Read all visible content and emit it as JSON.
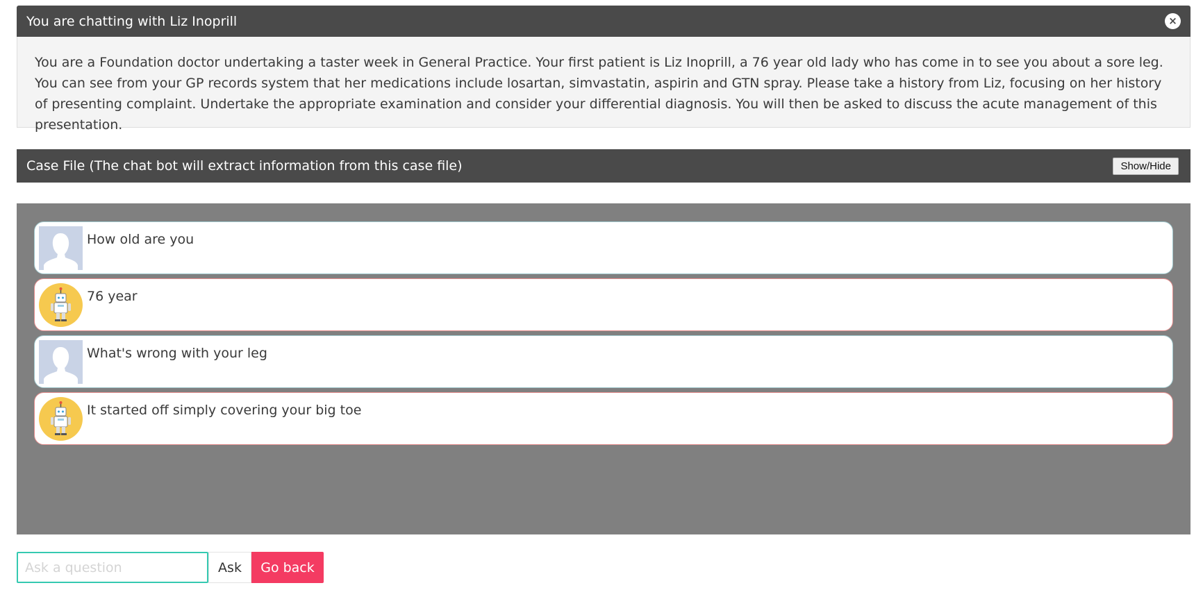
{
  "chat_panel": {
    "title": "You are chatting with Liz Inoprill",
    "close_label": "×",
    "intro_text": "You are a Foundation doctor undertaking a taster week in General Practice. Your first patient is Liz Inoprill, a 76 year old lady who has come in to see you about a sore leg. You can see from your GP records system that her medications include losartan, simvastatin, aspirin and GTN spray. Please take a history from Liz, focusing on her history of presenting complaint. Undertake the appropriate examination and consider your differential diagnosis. You will then be asked to discuss the acute management of this presentation."
  },
  "case_file": {
    "title": "Case File (The chat bot will extract information from this case file)",
    "toggle_label": "Show/Hide"
  },
  "messages": [
    {
      "sender": "user",
      "avatar_icon": "user-silhouette-icon",
      "text": "How old are you"
    },
    {
      "sender": "bot",
      "avatar_icon": "robot-icon",
      "text": "76 year"
    },
    {
      "sender": "user",
      "avatar_icon": "user-silhouette-icon",
      "text": "What's wrong with your leg"
    },
    {
      "sender": "bot",
      "avatar_icon": "robot-icon",
      "text": "It started off simply covering your big toe"
    }
  ],
  "composer": {
    "placeholder": "Ask a question",
    "value": "",
    "ask_label": "Ask",
    "back_label": "Go back"
  },
  "colors": {
    "header_bg": "#4a4a4a",
    "chat_bg": "#808080",
    "user_border": "#9fc7cc",
    "bot_border": "#e48c8c",
    "input_focus": "#35c9b1",
    "back_button": "#f43b62"
  }
}
